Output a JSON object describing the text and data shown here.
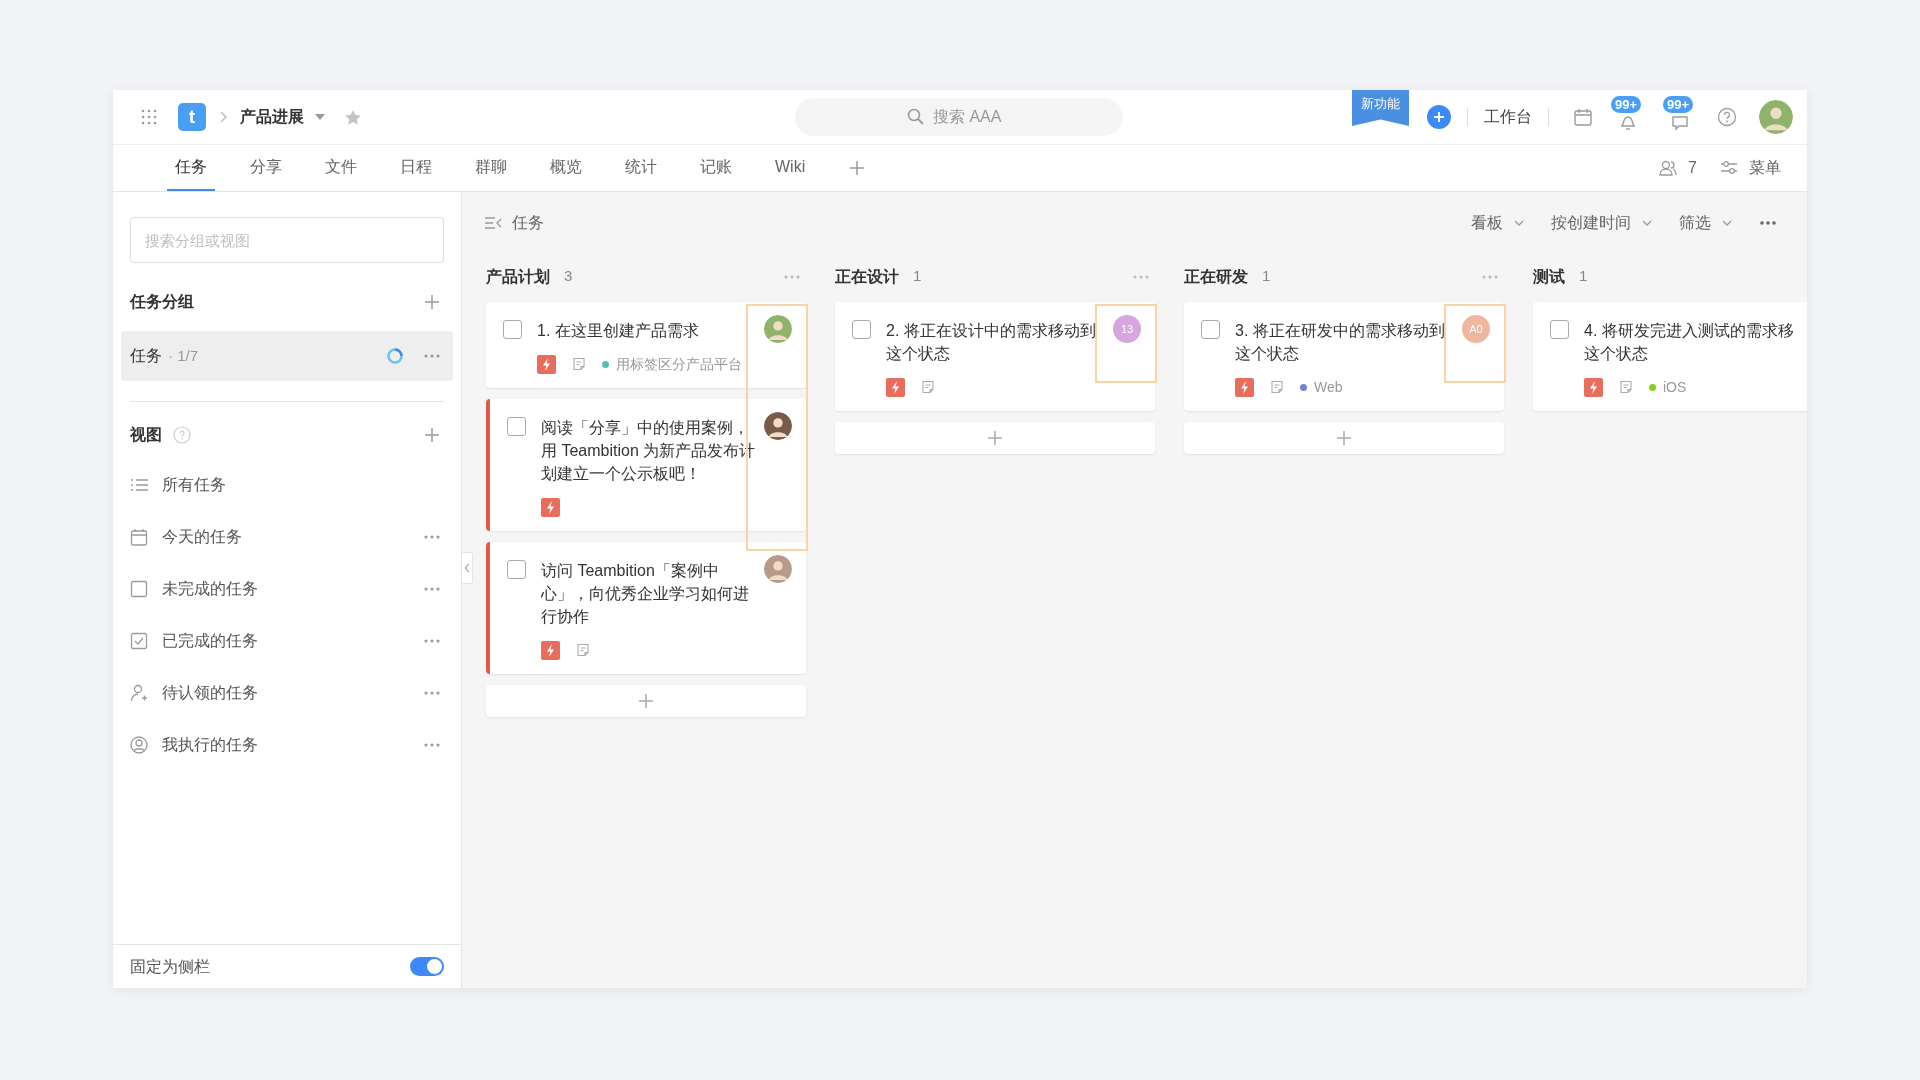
{
  "header": {
    "logo": "t",
    "project": "产品进展",
    "search_placeholder": "搜索 AAA",
    "new_feature": "新功能",
    "workbench": "工作台",
    "badges": [
      "99+",
      "99+"
    ]
  },
  "tabs": [
    {
      "label": "任务",
      "selected": true
    },
    {
      "label": "分享",
      "selected": false
    },
    {
      "label": "文件",
      "selected": false
    },
    {
      "label": "日程",
      "selected": false
    },
    {
      "label": "群聊",
      "selected": false
    },
    {
      "label": "概览",
      "selected": false
    },
    {
      "label": "统计",
      "selected": false
    },
    {
      "label": "记账",
      "selected": false
    },
    {
      "label": "Wiki",
      "selected": false
    }
  ],
  "members": "7",
  "menu": "菜单",
  "sidebar": {
    "search_placeholder": "搜索分组或视图",
    "groups_title": "任务分组",
    "groups": [
      {
        "label": "任务",
        "count": "· 1/7",
        "selected": true
      }
    ],
    "views_title": "视图",
    "views": [
      {
        "kind": "list",
        "label": "所有任务",
        "more": false
      },
      {
        "kind": "calendar",
        "label": "今天的任务",
        "more": true
      },
      {
        "kind": "box",
        "label": "未完成的任务",
        "more": true
      },
      {
        "kind": "checkbox",
        "label": "已完成的任务",
        "more": true
      },
      {
        "kind": "person-add",
        "label": "待认领的任务",
        "more": true
      },
      {
        "kind": "person",
        "label": "我执行的任务",
        "more": true
      }
    ],
    "pin": {
      "label": "固定为侧栏",
      "on": true
    }
  },
  "board": {
    "title": "任务",
    "controls": [
      "看板",
      "按创建时间",
      "筛选"
    ],
    "columns": [
      {
        "name": "产品计划",
        "count": "3",
        "menu": true,
        "add_button": true,
        "outline": true,
        "cards": [
          {
            "title": "1. 在这里创建产品需求",
            "checked": false,
            "flagged": false,
            "note": true,
            "tag": {
              "label": "用标签区分产品平台",
              "color": "#4fc1b7"
            },
            "avatar": {
              "kind": "photo",
              "color": "#8fb36a"
            }
          },
          {
            "title": "阅读「分享」中的使用案例，用 Teambition 为新产品发布计划建立一个公示板吧！",
            "checked": false,
            "flagged": true,
            "note": false,
            "avatar": {
              "kind": "photo",
              "color": "#7a5a48"
            }
          },
          {
            "title": "访问 Teambition「案例中心」，向优秀企业学习如何进行协作",
            "checked": false,
            "flagged": true,
            "note": true,
            "avatar": {
              "kind": "photo",
              "color": "#b89a88"
            }
          }
        ]
      },
      {
        "name": "正在设计",
        "count": "1",
        "menu": true,
        "add_button": true,
        "outline": true,
        "cards": [
          {
            "title": "2. 将正在设计中的需求移动到这个状态",
            "checked": false,
            "flagged": false,
            "note": true,
            "avatar": {
              "kind": "initials",
              "text": "13",
              "color": "#d7a6e0"
            }
          }
        ]
      },
      {
        "name": "正在研发",
        "count": "1",
        "menu": true,
        "add_button": true,
        "outline": true,
        "cards": [
          {
            "title": "3. 将正在研发中的需求移动到这个状态",
            "checked": false,
            "flagged": false,
            "note": true,
            "tag": {
              "label": "Web",
              "color": "#7b7fd4"
            },
            "avatar": {
              "kind": "initials",
              "text": "A0",
              "color": "#efb6a0"
            }
          }
        ]
      },
      {
        "name": "测试",
        "count": "1",
        "menu": false,
        "add_button": false,
        "outline": false,
        "cards": [
          {
            "title": "4. 将研发完进入测试的需求移这个状态",
            "checked": false,
            "flagged": false,
            "note": true,
            "tag": {
              "label": "iOS",
              "color": "#7ed321"
            }
          }
        ]
      }
    ]
  }
}
